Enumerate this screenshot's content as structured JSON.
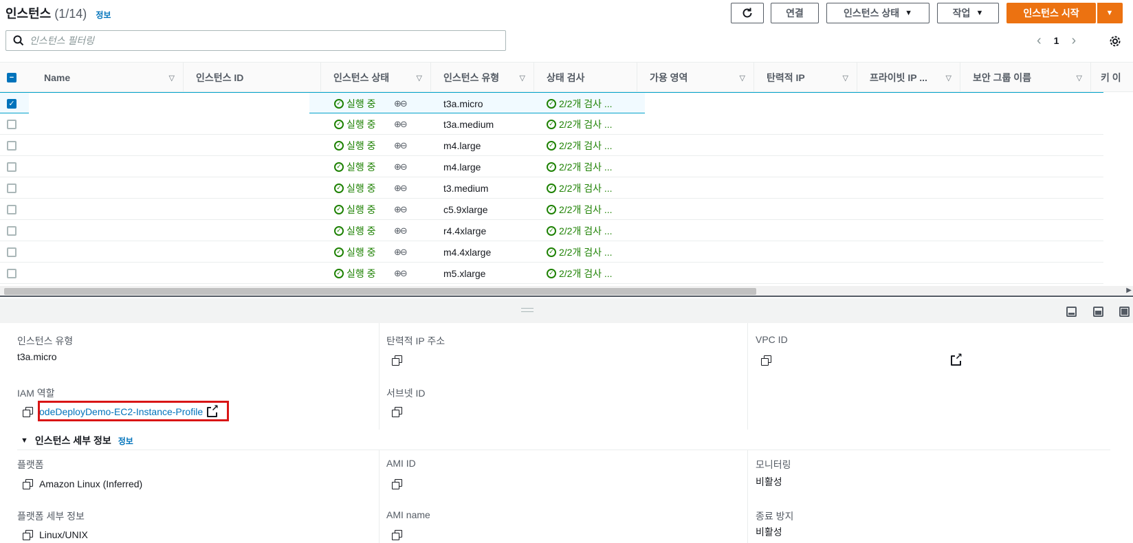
{
  "header": {
    "title": "인스턴스",
    "count": "(1/14)",
    "info": "정보",
    "refresh_icon": "refresh-icon",
    "connect": "연결",
    "instance_state": "인스턴스 상태",
    "actions": "작업",
    "launch": "인스턴스 시작"
  },
  "search": {
    "placeholder": "인스턴스 필터링"
  },
  "pager": {
    "page": "1"
  },
  "columns": [
    "Name",
    "인스턴스 ID",
    "인스턴스 상태",
    "인스턴스 유형",
    "상태 검사",
    "가용 영역",
    "탄력적 IP",
    "프라이빗 IP ...",
    "보안 그룹 이름",
    "키 이"
  ],
  "rows": [
    {
      "state": "실행 중",
      "type": "t3a.micro",
      "check": "2/2개 검사 ...",
      "selected": true
    },
    {
      "state": "실행 중",
      "type": "t3a.medium",
      "check": "2/2개 검사 ...",
      "selected": false
    },
    {
      "state": "실행 중",
      "type": "m4.large",
      "check": "2/2개 검사 ...",
      "selected": false
    },
    {
      "state": "실행 중",
      "type": "m4.large",
      "check": "2/2개 검사 ...",
      "selected": false
    },
    {
      "state": "실행 중",
      "type": "t3.medium",
      "check": "2/2개 검사 ...",
      "selected": false
    },
    {
      "state": "실행 중",
      "type": "c5.9xlarge",
      "check": "2/2개 검사 ...",
      "selected": false
    },
    {
      "state": "실행 중",
      "type": "r4.4xlarge",
      "check": "2/2개 검사 ...",
      "selected": false
    },
    {
      "state": "실행 중",
      "type": "m4.4xlarge",
      "check": "2/2개 검사 ...",
      "selected": false
    },
    {
      "state": "실행 중",
      "type": "m5.xlarge",
      "check": "2/2개 검사 ...",
      "selected": false
    }
  ],
  "details": {
    "instance_type_label": "인스턴스 유형",
    "instance_type_value": "t3a.micro",
    "elastic_ip_label": "탄력적 IP 주소",
    "vpc_id_label": "VPC ID",
    "iam_role_label": "IAM 역할",
    "iam_role_value": "odeDeployDemo-EC2-Instance-Profile",
    "subnet_id_label": "서브넷 ID",
    "section_title": "인스턴스 세부 정보",
    "section_info": "정보",
    "platform_label": "플랫폼",
    "platform_value": "Amazon Linux (Inferred)",
    "ami_id_label": "AMI ID",
    "monitoring_label": "모니터링",
    "monitoring_value": "비활성",
    "platform_details_label": "플랫폼 세부 정보",
    "platform_details_value": "Linux/UNIX",
    "ami_name_label": "AMI name",
    "termination_protection_label": "종료 방지",
    "termination_protection_value": "비활성"
  },
  "colors": {
    "primary": "#ec7211",
    "link": "#0073bb",
    "success": "#1d8102",
    "highlight": "#d91515"
  }
}
